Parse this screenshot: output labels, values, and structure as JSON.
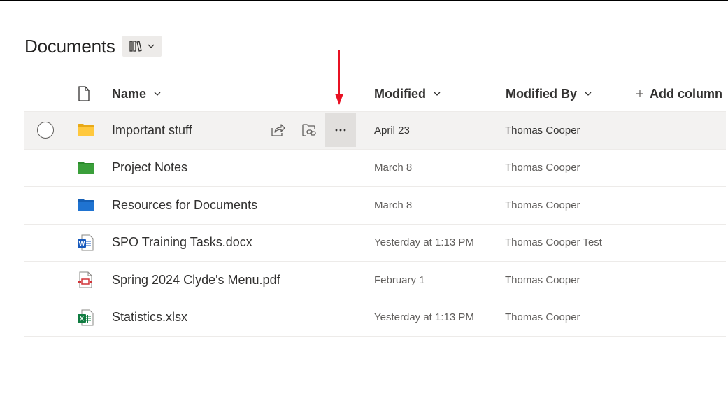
{
  "page": {
    "title": "Documents"
  },
  "columns": {
    "name": "Name",
    "modified": "Modified",
    "modified_by": "Modified By",
    "add_column": "Add column"
  },
  "rows": [
    {
      "name": "Important stuff",
      "modified": "April 23",
      "modified_by": "Thomas Cooper",
      "icon": "folder-yellow-icon"
    },
    {
      "name": "Project Notes",
      "modified": "March 8",
      "modified_by": "Thomas Cooper",
      "icon": "folder-green-icon"
    },
    {
      "name": "Resources for Documents",
      "modified": "March 8",
      "modified_by": "Thomas Cooper",
      "icon": "folder-blue-icon"
    },
    {
      "name": "SPO Training Tasks.docx",
      "modified": "Yesterday at 1:13 PM",
      "modified_by": "Thomas Cooper Test",
      "icon": "word-file-icon"
    },
    {
      "name": "Spring 2024 Clyde's Menu.pdf",
      "modified": "February 1",
      "modified_by": "Thomas Cooper",
      "icon": "pdf-file-icon"
    },
    {
      "name": "Statistics.xlsx",
      "modified": "Yesterday at 1:13 PM",
      "modified_by": "Thomas Cooper",
      "icon": "excel-file-icon"
    }
  ],
  "colors": {
    "arrow": "#e81123",
    "folder_yellow": "#ffc83d",
    "folder_green": "#3a9f3a",
    "folder_blue": "#1f73d1",
    "word_blue": "#185abd",
    "excel_green": "#107c41",
    "pdf_red": "#d13438"
  }
}
